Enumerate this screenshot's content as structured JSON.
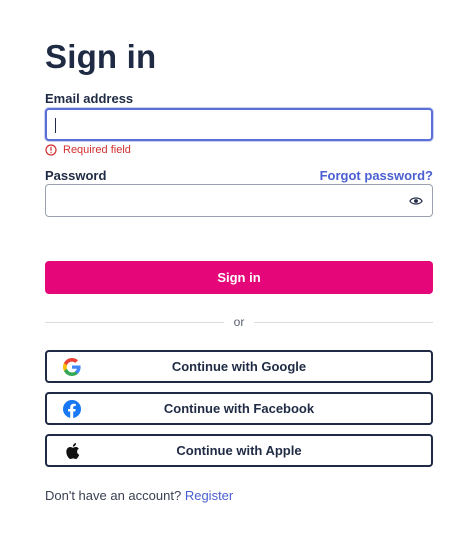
{
  "title": "Sign in",
  "email": {
    "label": "Email address",
    "value": "",
    "error": "Required field"
  },
  "password": {
    "label": "Password",
    "value": "",
    "forgot_link": "Forgot password?"
  },
  "submit_label": "Sign in",
  "divider_text": "or",
  "social": {
    "google": "Continue with Google",
    "facebook": "Continue with Facebook",
    "apple": "Continue with Apple"
  },
  "footer": {
    "prompt": "Don't have an account?",
    "register_link": "Register"
  },
  "colors": {
    "primary": "#e5077a",
    "link": "#4a5fd1",
    "error": "#d32f2f",
    "focus_border": "#5b6fd6",
    "text": "#1f2a44"
  }
}
